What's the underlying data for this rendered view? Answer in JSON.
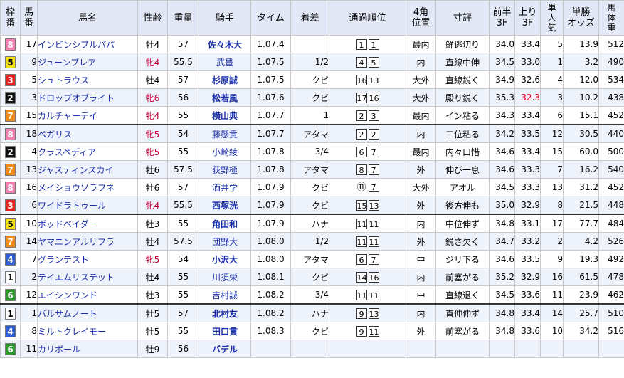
{
  "headers": {
    "waku": [
      "枠",
      "番"
    ],
    "uma": [
      "馬",
      "番"
    ],
    "name": "馬名",
    "sexage": "性齢",
    "weight": "重量",
    "jockey": "騎手",
    "time": "タイム",
    "margin": "着差",
    "passing": "通過順位",
    "corner": [
      "4角",
      "位置"
    ],
    "comment": "寸評",
    "first3f": [
      "前半",
      "3F"
    ],
    "last3f": [
      "上り",
      "3F"
    ],
    "pop": [
      "単",
      "人",
      "気"
    ],
    "odds": [
      "単勝",
      "オッズ"
    ],
    "bodyweight": [
      "馬",
      "体",
      "重"
    ]
  },
  "colors": {
    "header_bg": "#e3e8f7",
    "alt_row_bg": "#eef2fb",
    "link_blue": "#1a2ea8",
    "filly_red": "#c4003a",
    "fast_red": "#e0001a"
  },
  "rows": [
    {
      "waku": "8",
      "uma": "17",
      "name": "インビンシブルパパ",
      "sex": "牡4",
      "sex_f": false,
      "weight": "57",
      "jockey": "佐々木大",
      "jbold": true,
      "time": "1.07.4",
      "margin": "",
      "pass": [
        "1",
        "1"
      ],
      "corner": "最内",
      "comment": "鮮逃切り",
      "f3": "34.0",
      "l3": "33.4",
      "l3red": false,
      "pop": "5",
      "odds": "13.9",
      "bw": "512",
      "sep": false
    },
    {
      "waku": "5",
      "uma": "9",
      "name": "ジューンブレア",
      "sex": "牝4",
      "sex_f": true,
      "weight": "55.5",
      "jockey": "武豊",
      "jbold": false,
      "time": "1.07.5",
      "margin": "1/2",
      "pass": [
        "4",
        "5"
      ],
      "corner": "内",
      "comment": "直線中伸",
      "f3": "34.5",
      "l3": "33.0",
      "l3red": false,
      "pop": "1",
      "odds": "3.2",
      "bw": "490",
      "sep": false
    },
    {
      "waku": "3",
      "uma": "5",
      "name": "シュトラウス",
      "sex": "牡4",
      "sex_f": false,
      "weight": "57",
      "jockey": "杉原誠",
      "jbold": true,
      "time": "1.07.5",
      "margin": "クビ",
      "pass": [
        "16",
        "13"
      ],
      "corner": "大外",
      "comment": "直線鋭く",
      "f3": "34.9",
      "l3": "32.6",
      "l3red": false,
      "pop": "4",
      "odds": "12.0",
      "bw": "534",
      "sep": false
    },
    {
      "waku": "2",
      "uma": "3",
      "name": "ドロップオブライト",
      "sex": "牝6",
      "sex_f": true,
      "weight": "56",
      "jockey": "松若風",
      "jbold": true,
      "time": "1.07.6",
      "margin": "クビ",
      "pass": [
        "17",
        "16"
      ],
      "corner": "大外",
      "comment": "殿り鋭く",
      "f3": "35.3",
      "l3": "32.3",
      "l3red": true,
      "pop": "3",
      "odds": "10.2",
      "bw": "438",
      "sep": false
    },
    {
      "waku": "7",
      "uma": "15",
      "name": "カルチャーデイ",
      "sex": "牝4",
      "sex_f": true,
      "weight": "55",
      "jockey": "横山典",
      "jbold": true,
      "time": "1.07.7",
      "margin": "1",
      "pass": [
        "2",
        "3"
      ],
      "corner": "最内",
      "comment": "イン粘る",
      "f3": "34.3",
      "l3": "33.4",
      "l3red": false,
      "pop": "6",
      "odds": "15.1",
      "bw": "452",
      "sep": true
    },
    {
      "waku": "8",
      "uma": "18",
      "name": "ペガリス",
      "sex": "牝5",
      "sex_f": true,
      "weight": "54",
      "jockey": "藤懸貴",
      "jbold": false,
      "time": "1.07.7",
      "margin": "アタマ",
      "pass": [
        "2",
        "2"
      ],
      "corner": "内",
      "comment": "二位粘る",
      "f3": "34.2",
      "l3": "33.5",
      "l3red": false,
      "pop": "12",
      "odds": "30.5",
      "bw": "440",
      "sep": false
    },
    {
      "waku": "2",
      "uma": "4",
      "name": "クラスペディア",
      "sex": "牝5",
      "sex_f": true,
      "weight": "55",
      "jockey": "小崎綾",
      "jbold": false,
      "time": "1.07.8",
      "margin": "3/4",
      "pass": [
        "6",
        "7"
      ],
      "corner": "最内",
      "comment": "内々口惜",
      "f3": "34.6",
      "l3": "33.4",
      "l3red": false,
      "pop": "15",
      "odds": "60.0",
      "bw": "500",
      "sep": false
    },
    {
      "waku": "7",
      "uma": "13",
      "name": "ジャスティンスカイ",
      "sex": "牡6",
      "sex_f": false,
      "weight": "57.5",
      "jockey": "荻野極",
      "jbold": false,
      "time": "1.07.8",
      "margin": "アタマ",
      "pass": [
        "8",
        "7"
      ],
      "corner": "外",
      "comment": "伸び一息",
      "f3": "34.6",
      "l3": "33.3",
      "l3red": false,
      "pop": "7",
      "odds": "16.2",
      "bw": "540",
      "sep": false
    },
    {
      "waku": "8",
      "uma": "16",
      "name": "メイショウソラフネ",
      "sex": "牡6",
      "sex_f": false,
      "weight": "57",
      "jockey": "酒井学",
      "jbold": false,
      "time": "1.07.9",
      "margin": "クビ",
      "pass": [
        "⑪",
        "7"
      ],
      "corner": "大外",
      "comment": "アオル",
      "f3": "34.5",
      "l3": "33.3",
      "l3red": false,
      "pop": "13",
      "odds": "31.2",
      "bw": "452",
      "sep": false
    },
    {
      "waku": "3",
      "uma": "6",
      "name": "ワイドラトゥール",
      "sex": "牝4",
      "sex_f": true,
      "weight": "55.5",
      "jockey": "西塚洸",
      "jbold": true,
      "time": "1.07.9",
      "margin": "クビ",
      "pass": [
        "15",
        "13"
      ],
      "corner": "外",
      "comment": "後方伸も",
      "f3": "35.0",
      "l3": "32.9",
      "l3red": false,
      "pop": "8",
      "odds": "21.5",
      "bw": "448",
      "sep": true
    },
    {
      "waku": "5",
      "uma": "10",
      "name": "ボッドベイダー",
      "sex": "牡3",
      "sex_f": false,
      "weight": "55",
      "jockey": "角田和",
      "jbold": true,
      "time": "1.07.9",
      "margin": "ハナ",
      "pass": [
        "11",
        "11"
      ],
      "corner": "内",
      "comment": "中位伸ず",
      "f3": "34.8",
      "l3": "33.1",
      "l3red": false,
      "pop": "17",
      "odds": "77.7",
      "bw": "484",
      "sep": false
    },
    {
      "waku": "7",
      "uma": "14",
      "name": "ヤマニンアルリフラ",
      "sex": "牡4",
      "sex_f": false,
      "weight": "57.5",
      "jockey": "団野大",
      "jbold": false,
      "time": "1.08.0",
      "margin": "1/2",
      "pass": [
        "11",
        "11"
      ],
      "corner": "外",
      "comment": "鋭さ欠く",
      "f3": "34.7",
      "l3": "33.2",
      "l3red": false,
      "pop": "2",
      "odds": "4.2",
      "bw": "526",
      "sep": false
    },
    {
      "waku": "4",
      "uma": "7",
      "name": "グランテスト",
      "sex": "牝5",
      "sex_f": true,
      "weight": "54",
      "jockey": "小沢大",
      "jbold": true,
      "time": "1.08.0",
      "margin": "アタマ",
      "pass": [
        "6",
        "7"
      ],
      "corner": "中",
      "comment": "ジリ下る",
      "f3": "34.6",
      "l3": "33.5",
      "l3red": false,
      "pop": "9",
      "odds": "19.3",
      "bw": "492",
      "sep": false
    },
    {
      "waku": "1",
      "uma": "2",
      "name": "テイエムリステット",
      "sex": "牡4",
      "sex_f": false,
      "weight": "55",
      "jockey": "川須栄",
      "jbold": false,
      "time": "1.08.1",
      "margin": "クビ",
      "pass": [
        "14",
        "16"
      ],
      "corner": "内",
      "comment": "前塞がる",
      "f3": "35.2",
      "l3": "32.9",
      "l3red": false,
      "pop": "16",
      "odds": "61.5",
      "bw": "478",
      "sep": false
    },
    {
      "waku": "6",
      "uma": "12",
      "name": "エイシンワンド",
      "sex": "牡3",
      "sex_f": false,
      "weight": "55",
      "jockey": "吉村誠",
      "jbold": false,
      "time": "1.08.2",
      "margin": "3/4",
      "pass": [
        "11",
        "11"
      ],
      "corner": "中",
      "comment": "直線退く",
      "f3": "34.5",
      "l3": "33.6",
      "l3red": false,
      "pop": "11",
      "odds": "23.9",
      "bw": "462",
      "sep": true
    },
    {
      "waku": "1",
      "uma": "1",
      "name": "バルサムノート",
      "sex": "牡5",
      "sex_f": false,
      "weight": "57",
      "jockey": "北村友",
      "jbold": true,
      "time": "1.08.2",
      "margin": "ハナ",
      "pass": [
        "9",
        "13"
      ],
      "corner": "内",
      "comment": "直伸伸ず",
      "f3": "34.8",
      "l3": "33.4",
      "l3red": false,
      "pop": "14",
      "odds": "25.7",
      "bw": "510",
      "sep": false
    },
    {
      "waku": "4",
      "uma": "8",
      "name": "ミルトクレイモー",
      "sex": "牡5",
      "sex_f": false,
      "weight": "55",
      "jockey": "田口貫",
      "jbold": true,
      "time": "1.08.3",
      "margin": "クビ",
      "pass": [
        "9",
        "11"
      ],
      "corner": "外",
      "comment": "前塞がる",
      "f3": "34.8",
      "l3": "33.6",
      "l3red": false,
      "pop": "10",
      "odds": "34.2",
      "bw": "516",
      "sep": false
    },
    {
      "waku": "6",
      "uma": "11",
      "name": "カリボール",
      "sex": "牡9",
      "sex_f": false,
      "weight": "56",
      "jockey": "バデル",
      "jbold": true,
      "time": "",
      "margin": "",
      "pass": [],
      "corner": "",
      "comment": "",
      "f3": "",
      "l3": "",
      "l3red": false,
      "pop": "",
      "odds": "",
      "bw": "",
      "sep": false
    }
  ]
}
